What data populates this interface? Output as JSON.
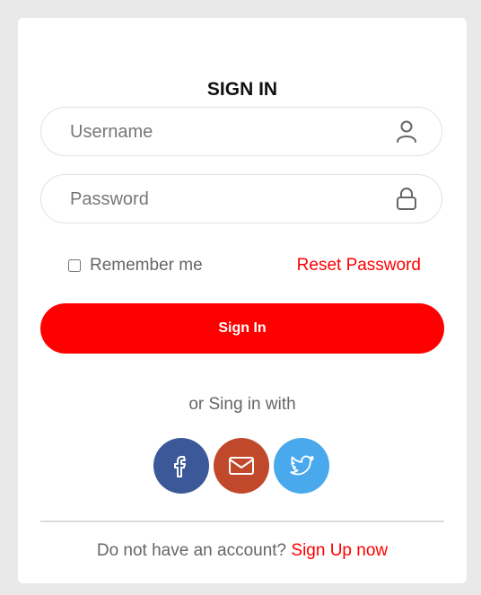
{
  "form": {
    "title": "SIGN IN",
    "username_placeholder": "Username",
    "password_placeholder": "Password",
    "remember_label": "Remember me",
    "reset_label": "Reset Password",
    "submit_label": "Sign In",
    "alt_text": "or Sing in with",
    "footer_text": "Do not have an account? ",
    "signup_label": "Sign Up now"
  },
  "social": [
    {
      "icon": "facebook-icon",
      "color": "#3b5998"
    },
    {
      "icon": "mail-icon",
      "color": "#c0492b"
    },
    {
      "icon": "twitter-icon",
      "color": "#4aa8ec"
    }
  ],
  "colors": {
    "accent": "#ff0000",
    "background": "#e9e9e9"
  }
}
